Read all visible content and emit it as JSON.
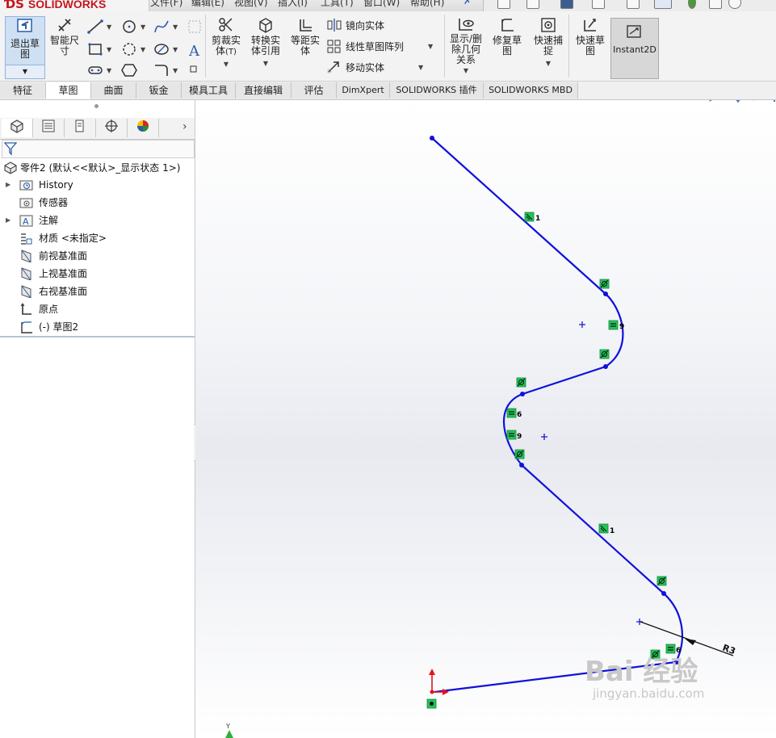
{
  "app": {
    "brand": "SOLIDWORKS",
    "menus": [
      "文件(F)",
      "编辑(E)",
      "视图(V)",
      "插入(I)",
      "工具(T)",
      "窗口(W)",
      "帮助(H)"
    ]
  },
  "toolbar": {
    "exit_sketch": "退出草\n图",
    "smart_dim": "智能尺\n寸",
    "trim": "剪裁实\n体",
    "trim_hint": "(T)",
    "convert": "转换实\n体引用",
    "offset": "等距实\n体",
    "mirror": "镜向实体",
    "linear_pattern": "线性草图阵列",
    "move": "移动实体",
    "show_delete": "显示/删\n除几何\n关系",
    "repair": "修复草\n图",
    "quick_snap": "快速捕\n捉",
    "quick_sketch": "快速草\n图",
    "instant2d": "Instant2D"
  },
  "tabs": [
    "特征",
    "草图",
    "曲面",
    "钣金",
    "模具工具",
    "直接编辑",
    "评估",
    "DimXpert",
    "SOLIDWORKS 插件",
    "SOLIDWORKS MBD"
  ],
  "active_tab": "草图",
  "tree": {
    "root": "零件2 (默认<<默认>_显示状态 1>)",
    "items": [
      {
        "label": "History",
        "expandable": true,
        "icon": "history-folder-icon"
      },
      {
        "label": "传感器",
        "expandable": false,
        "icon": "sensor-icon"
      },
      {
        "label": "注解",
        "expandable": true,
        "icon": "annotation-icon"
      },
      {
        "label": "材质 <未指定>",
        "expandable": false,
        "icon": "material-icon"
      },
      {
        "label": "前视基准面",
        "expandable": false,
        "icon": "plane-icon"
      },
      {
        "label": "上视基准面",
        "expandable": false,
        "icon": "plane-icon"
      },
      {
        "label": "右视基准面",
        "expandable": false,
        "icon": "plane-icon"
      },
      {
        "label": "原点",
        "expandable": false,
        "icon": "origin-icon"
      },
      {
        "label": "(-) 草图2",
        "expandable": false,
        "icon": "sketch-icon"
      }
    ]
  },
  "sketch": {
    "dimension_label": "R3",
    "relation_labels": [
      "1",
      "9",
      "6",
      "9",
      "1",
      "6"
    ],
    "axis_label": "Y"
  },
  "colors": {
    "sketch_line": "#1111dd",
    "relation_badge": "#22c35a",
    "origin": "#e0161c",
    "accent": "#c4161c"
  },
  "watermark": {
    "main": "Bai 经验",
    "sub": "jingyan.baidu.com"
  }
}
